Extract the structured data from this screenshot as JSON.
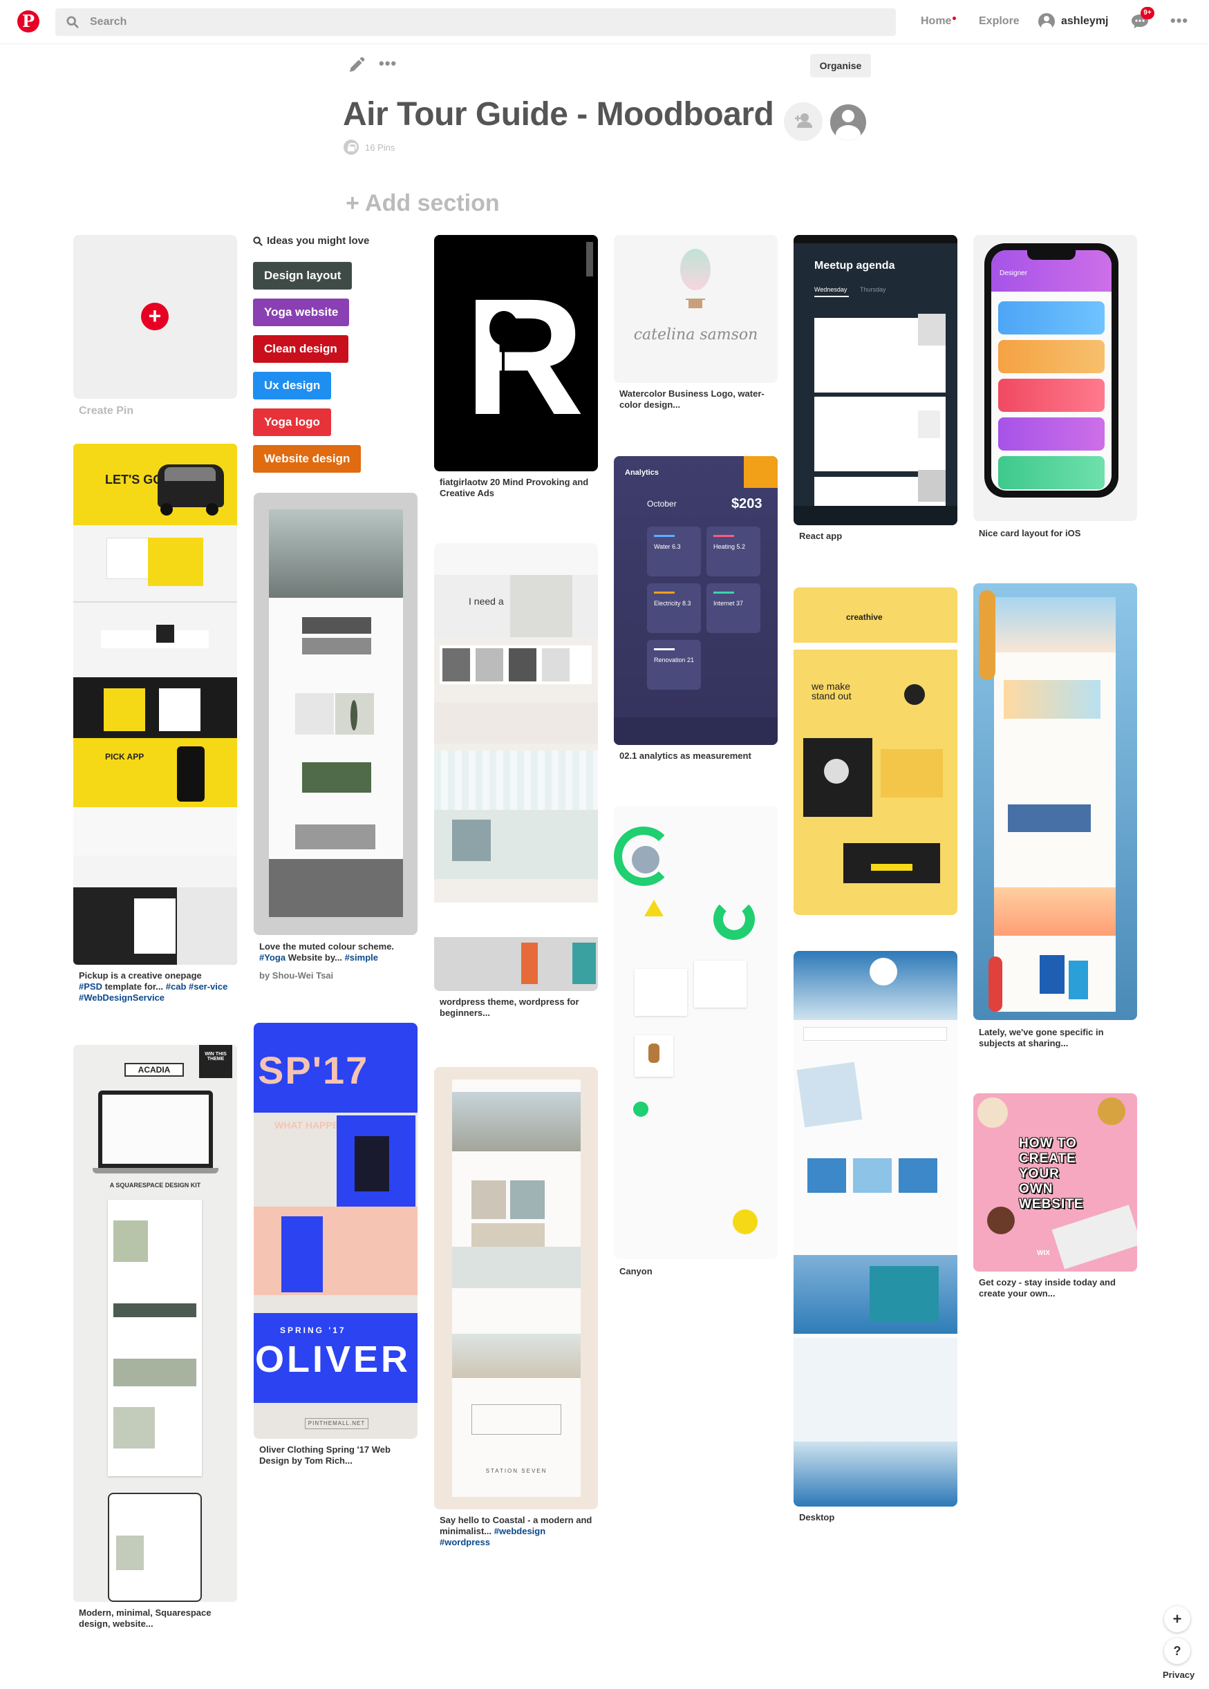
{
  "header": {
    "logo": "P",
    "search_placeholder": "Search",
    "nav": {
      "home": "Home",
      "explore": "Explore",
      "user": "ashleymj",
      "badge": "9+"
    }
  },
  "board": {
    "title": "Air Tour Guide - Moodboard",
    "pin_count": "16 Pins",
    "organise": "Organise",
    "add_section": "+ Add section"
  },
  "create_pin": {
    "label": "Create Pin"
  },
  "ideas": {
    "heading": "Ideas you might love",
    "buttons": [
      {
        "label": "Design layout",
        "color": "#3f4b47"
      },
      {
        "label": "Yoga website",
        "color": "#8a3fb3"
      },
      {
        "label": "Clean design",
        "color": "#c90f1c"
      },
      {
        "label": "Ux design",
        "color": "#1f8ef1"
      },
      {
        "label": "Yoga logo",
        "color": "#e8323a"
      },
      {
        "label": "Website design",
        "color": "#e06b10"
      }
    ]
  },
  "pins": {
    "pickup": {
      "caption_a": "Pickup is a creative onepage",
      "tag_a": "#PSD",
      "caption_b": "template for...",
      "tag_b": "#cab #ser-vice #WebDesignService",
      "hero": "LET'S GO",
      "app": "PICK APP"
    },
    "acadia": {
      "caption": "Modern, minimal, Squarespace design, website...",
      "brand": "ACADIA",
      "kit": "A SQUARESPACE DESIGN KIT",
      "badge": "WIN THIS THEME"
    },
    "muted": {
      "caption_a": "Love the muted colour scheme.",
      "tag_a": "#Yoga",
      "caption_b": "Website by...",
      "tag_b": "#simple",
      "author": "by Shou-Wei Tsai"
    },
    "oliver": {
      "caption": "Oliver Clothing Spring '17 Web Design by Tom Rich...",
      "headline": "SP'17",
      "spring": "SPRING '17",
      "name": "OLIVER",
      "site": "PINTHEMALL.NET"
    },
    "fiat": {
      "caption": "fiatgirlaotw 20 Mind Provoking and Creative Ads",
      "letter": "R"
    },
    "wordpress": {
      "caption": "wordpress theme, wordpress for beginners...",
      "need": "I need a"
    },
    "coastal": {
      "caption_a": "Say hello to Coastal - a modern and minimalist...",
      "tag": "#webdesign #wordpress",
      "footer": "STATION SEVEN"
    },
    "watercolor": {
      "caption": "Watercolor Business Logo, water-color design...",
      "script": "catelina samson"
    },
    "analytics": {
      "caption": "02.1 analytics as measurement",
      "title": "Analytics",
      "month": "October",
      "amount": "$203",
      "tiles": [
        "Water 6.3",
        "Heating 5.2",
        "Electricity 8.3",
        "Internet 37",
        "Renovation 21"
      ]
    },
    "canyon": {
      "caption": "Canyon"
    },
    "react": {
      "caption": "React app",
      "title": "Meetup agenda",
      "tabs": [
        "Wednesday",
        "Thursday"
      ]
    },
    "creathive": {
      "brand": "creathive",
      "line": "we make stand out"
    },
    "desktop": {
      "caption": "Desktop"
    },
    "ios": {
      "caption": "Nice card layout for iOS",
      "title": "Designer"
    },
    "lately": {
      "caption": "Lately, we've gone specific in subjects at sharing..."
    },
    "cozy": {
      "caption": "Get cozy - stay inside today and create your own...",
      "line1": "HOW TO",
      "line2": "CREATE",
      "line3": "YOUR OWN",
      "line4": "WEBSITE",
      "brand": "WIX"
    }
  },
  "footer": {
    "plus": "+",
    "help": "?",
    "privacy": "Privacy"
  }
}
